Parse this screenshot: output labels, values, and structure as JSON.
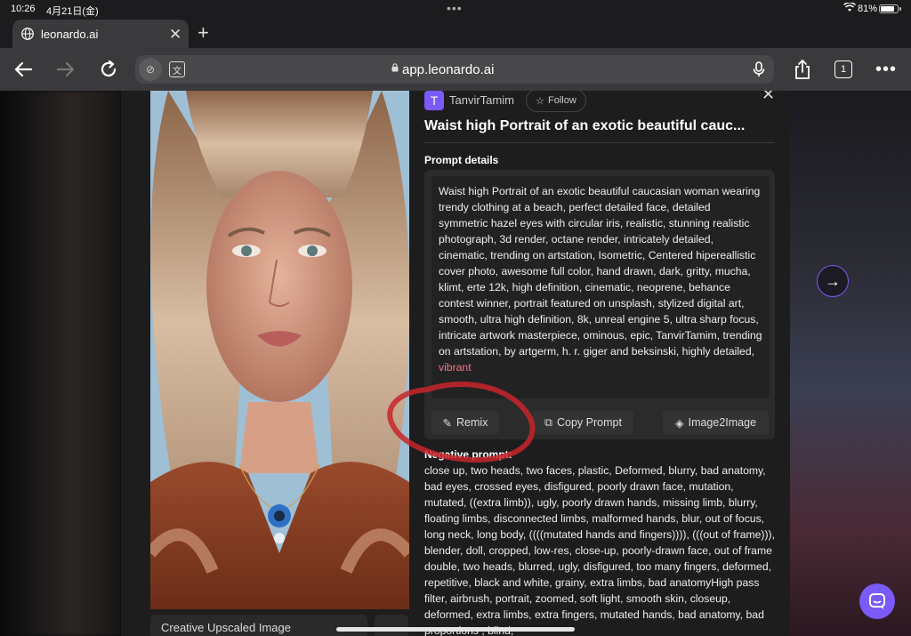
{
  "status_bar": {
    "time": "10:26",
    "date": "4月21日(金)",
    "battery_percent": "81%",
    "battery_level": 0.81
  },
  "browser": {
    "tab_title": "leonardo.ai",
    "url": "app.leonardo.ai",
    "tab_count": "1",
    "icons": [
      "back-icon",
      "forward-icon",
      "reload-icon",
      "shield-icon",
      "translate-icon",
      "lock-icon",
      "mic-icon",
      "share-icon",
      "tabs-icon",
      "more-icon"
    ]
  },
  "image_modal": {
    "avatar_letter": "T",
    "username": "TanvirTamim",
    "follow_label": "Follow",
    "title": "Waist high Portrait of an exotic beautiful cauc...",
    "prompt_details_label": "Prompt details",
    "prompt_text": "Waist high Portrait of an exotic beautiful caucasian woman wearing trendy clothing at a beach, perfect detailed face, detailed symmetric hazel eyes with circular iris, realistic, stunning realistic photograph, 3d render, octane render, intricately detailed, cinematic, trending on artstation, Isometric, Centered hipereallistic cover photo, awesome full color, hand drawn, dark, gritty, mucha, klimt, erte 12k, high definition, cinematic, neoprene, behance contest winner, portrait featured on unsplash, stylized digital art, smooth, ultra high definition, 8k, unreal engine 5, ultra sharp focus, intricate artwork masterpiece, ominous, epic, TanvirTamim, trending on artstation, by artgerm, h. r. giger and beksinski, highly detailed,",
    "prompt_text_faded": "vibrant",
    "remix_label": "Remix",
    "copy_prompt_label": "Copy Prompt",
    "image2image_label": "Image2Image",
    "negative_prompt_label": "Negative prompt:",
    "negative_prompt_text": "close up, two heads, two faces, plastic, Deformed, blurry, bad anatomy, bad eyes, crossed eyes, disfigured, poorly drawn face, mutation, mutated, ((extra limb)), ugly, poorly drawn hands, missing limb, blurry, floating limbs, disconnected limbs, malformed hands, blur, out of focus, long neck, long body, ((((mutated hands and fingers)))), (((out of frame))), blender, doll, cropped, low-res, close-up, poorly-drawn face, out of frame double, two heads, blurred, ugly, disfigured, too many fingers, deformed, repetitive, black and white, grainy, extra limbs, bad anatomyHigh pass filter, airbrush, portrait, zoomed, soft light, smooth skin, closeup, deformed, extra limbs, extra fingers, mutated hands, bad anatomy, bad proportions , blind,",
    "image_caption": "Creative Upscaled Image"
  },
  "colors": {
    "accent": "#7a5af8",
    "annotation_circle": "#c8242a",
    "modal_bg": "#1d1d1d"
  }
}
